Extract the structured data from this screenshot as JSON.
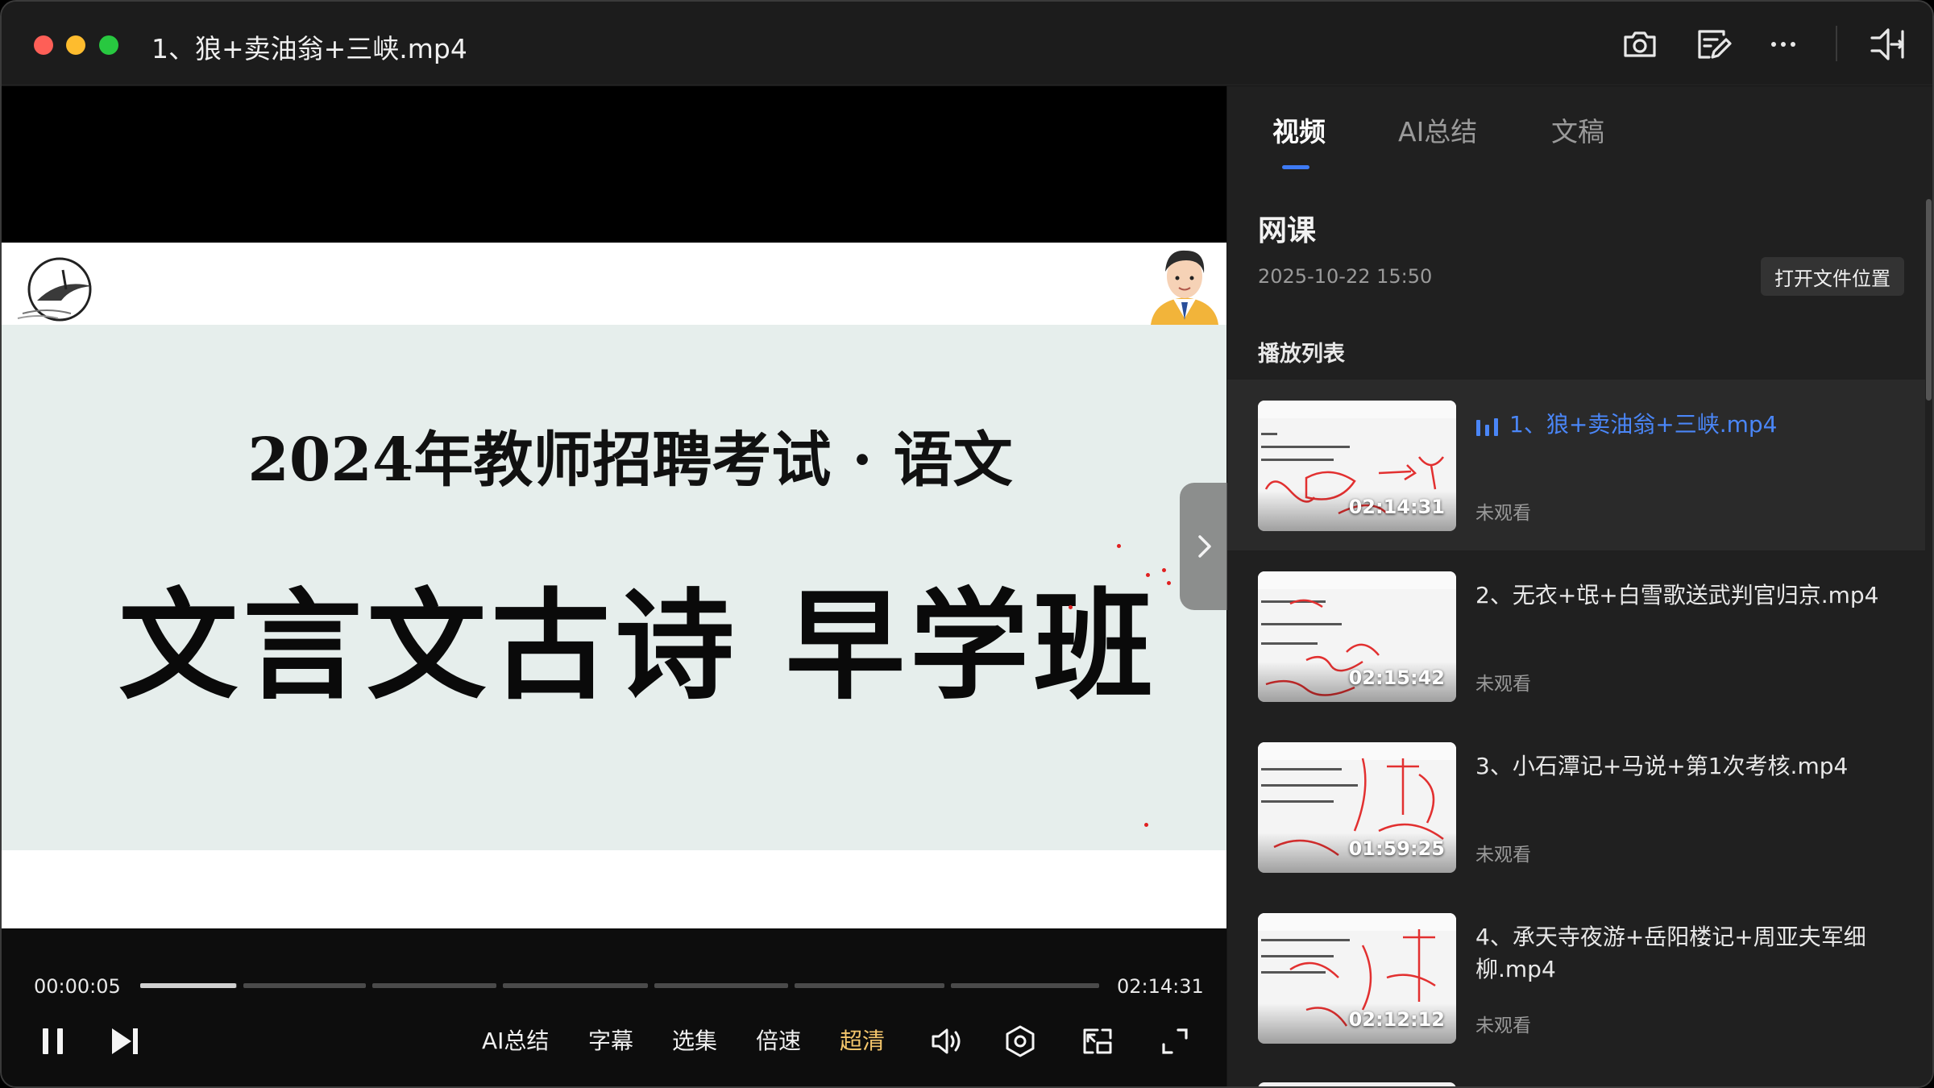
{
  "window": {
    "title": "1、狼+卖油翁+三峡.mp4"
  },
  "slide": {
    "subtitle": "2024年教师招聘考试 · 语文",
    "main_title": "文言文古诗 早学班"
  },
  "player": {
    "current_time": "00:00:05",
    "total_time": "02:14:31",
    "progress_fraction": 0.1,
    "controls": {
      "ai_summary": "AI总结",
      "subtitles": "字幕",
      "episodes": "选集",
      "speed": "倍速",
      "quality": "超清"
    },
    "quality_color": "#f3c56b"
  },
  "panel": {
    "tabs": [
      "视频",
      "AI总结",
      "文稿"
    ],
    "active_tab": 0,
    "accent_color": "#3e7bf5",
    "section_title": "网课",
    "section_date": "2025-10-22 15:50",
    "open_folder_label": "打开文件位置",
    "playlist_title": "播放列表",
    "items": [
      {
        "title": "1、狼+卖油翁+三峡.mp4",
        "duration": "02:14:31",
        "status": "未观看",
        "active": true
      },
      {
        "title": "2、无衣+氓+白雪歌送武判官归京.mp4",
        "duration": "02:15:42",
        "status": "未观看",
        "active": false
      },
      {
        "title": "3、小石潭记+马说+第1次考核.mp4",
        "duration": "01:59:25",
        "status": "未观看",
        "active": false
      },
      {
        "title": "4、承天寺夜游+岳阳楼记+周亚夫军细柳.mp4",
        "duration": "02:12:12",
        "status": "未观看",
        "active": false
      }
    ]
  },
  "icons": {
    "titlebar": [
      "camera-icon",
      "edit-note-icon",
      "more-icon",
      "pin-window-icon"
    ],
    "controls": [
      "pause-icon",
      "next-icon",
      "volume-icon",
      "settings-icon",
      "pip-icon",
      "fullscreen-icon"
    ]
  }
}
